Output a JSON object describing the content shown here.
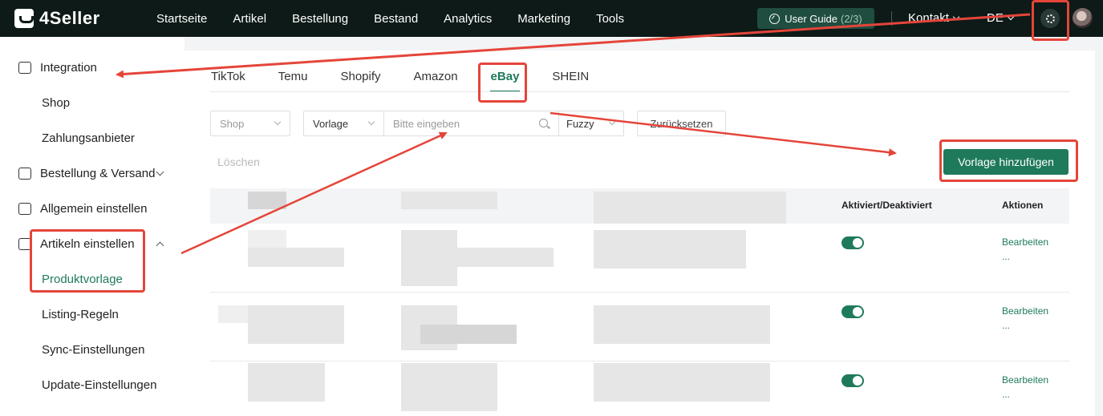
{
  "header": {
    "brand": "4Seller",
    "nav": [
      "Startseite",
      "Artikel",
      "Bestellung",
      "Bestand",
      "Analytics",
      "Marketing",
      "Tools"
    ],
    "user_guide_label": "User Guide",
    "user_guide_count": "(2/3)",
    "contact_label": "Kontakt",
    "language": "DE"
  },
  "sidebar": {
    "items": [
      {
        "label": "Integration"
      },
      {
        "label": "Shop"
      },
      {
        "label": "Zahlungsanbieter"
      },
      {
        "label": "Bestellung & Versand"
      },
      {
        "label": "Allgemein einstellen"
      },
      {
        "label": "Artikeln einstellen"
      },
      {
        "label": "Produktvorlage"
      },
      {
        "label": "Listing-Regeln"
      },
      {
        "label": "Sync-Einstellungen"
      },
      {
        "label": "Update-Einstellungen"
      }
    ]
  },
  "main": {
    "tabs": [
      "TikTok",
      "Temu",
      "Shopify",
      "Amazon",
      "eBay",
      "SHEIN"
    ],
    "active_tab": "eBay",
    "filters": {
      "shop_placeholder": "Shop",
      "field_select": "Vorlage",
      "search_placeholder": "Bitte eingeben",
      "match_mode": "Fuzzy",
      "reset_label": "Zurücksetzen"
    },
    "delete_label": "Löschen",
    "add_template_label": "Vorlage hinzufügen",
    "table": {
      "columns": {
        "status": "Aktiviert/Deaktiviert",
        "actions": "Aktionen"
      },
      "rows": [
        {
          "enabled": true,
          "edit": "Bearbeiten",
          "more": "..."
        },
        {
          "enabled": true,
          "edit": "Bearbeiten",
          "more": "..."
        },
        {
          "enabled": true,
          "edit": "Bearbeiten",
          "more": "..."
        }
      ]
    }
  },
  "colors": {
    "accent": "#1f7a5c",
    "topbar": "#0d1a17",
    "annotation": "#e5453a"
  }
}
